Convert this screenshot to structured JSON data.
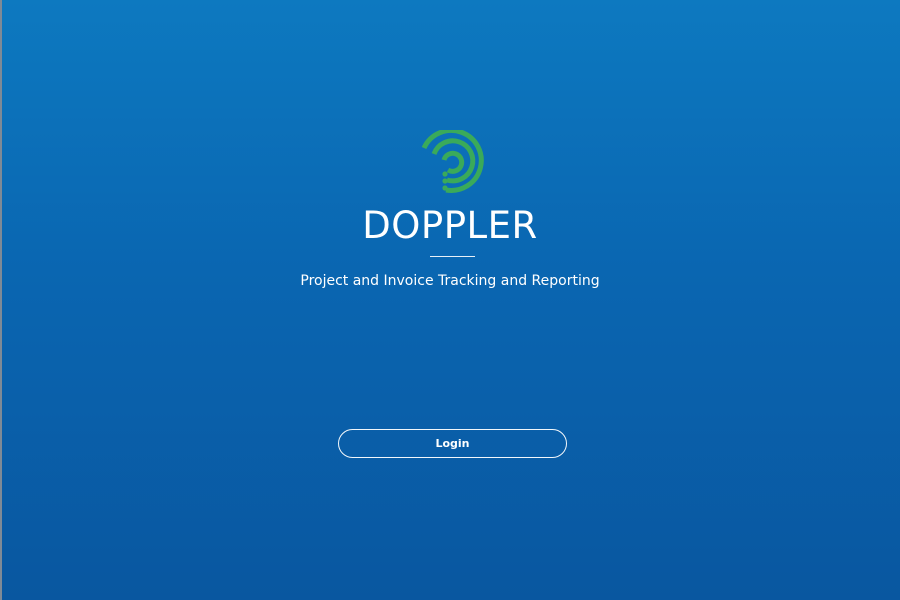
{
  "app": {
    "title": "DOPPLER",
    "subtitle": "Project and Invoice Tracking and Reporting",
    "logo_icon": "doppler-radar-logo-icon"
  },
  "actions": {
    "login_label": "Login"
  },
  "colors": {
    "background_top": "#0d79c0",
    "background_bottom": "#0957a0",
    "logo_green": "#3aaa5a",
    "text": "#ffffff"
  }
}
